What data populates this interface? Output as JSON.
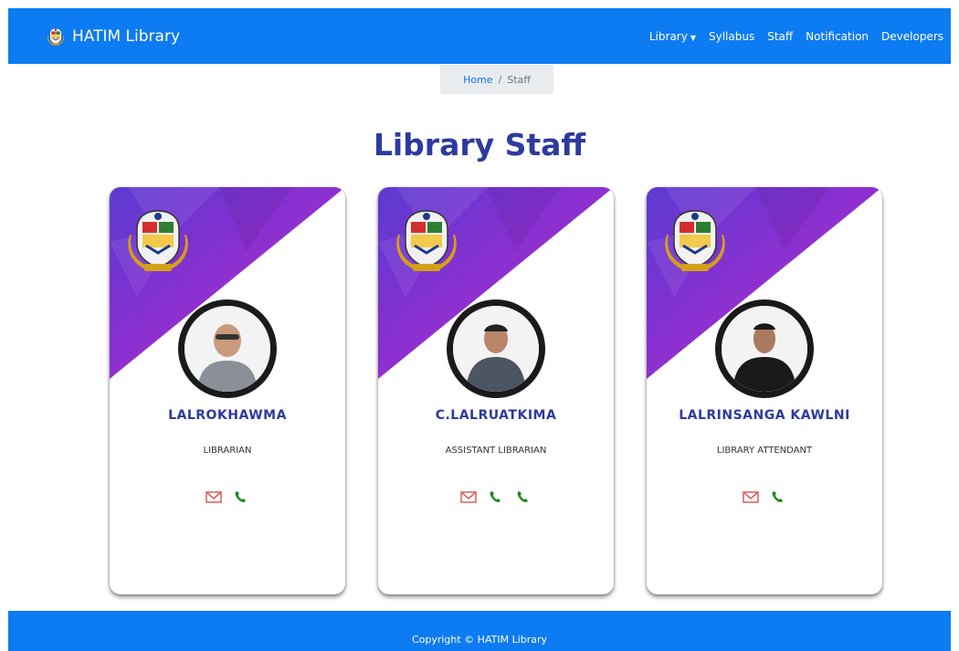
{
  "brand": {
    "name": "HATIM Library",
    "logo_icon": "college-crest-icon"
  },
  "nav": {
    "library": "Library",
    "syllabus": "Syllabus",
    "staff": "Staff",
    "notification": "Notification",
    "developers": "Developers"
  },
  "breadcrumb": {
    "home": "Home",
    "separator": "/",
    "current": "Staff"
  },
  "page_title": "Library Staff",
  "staff": [
    {
      "name": "LALROKHAWMA",
      "role": "LIBRARIAN",
      "contact_icons": [
        "envelope-icon",
        "phone-icon"
      ]
    },
    {
      "name": "C.LALRUATKIMA",
      "role": "ASSISTANT LIBRARIAN",
      "contact_icons": [
        "envelope-icon",
        "phone-icon",
        "phone-icon"
      ]
    },
    {
      "name": "LALRINSANGA KAWLNI",
      "role": "LIBRARY ATTENDANT",
      "contact_icons": [
        "envelope-icon",
        "phone-icon"
      ]
    }
  ],
  "footer": {
    "text": "Copyright © HATIM Library"
  },
  "colors": {
    "navbar": "#0d7bf2",
    "title": "#2d3a9f",
    "card_purple": "#7b2bd6",
    "email_icon": "#e05a5a",
    "phone_icon": "#1f8a1f"
  }
}
